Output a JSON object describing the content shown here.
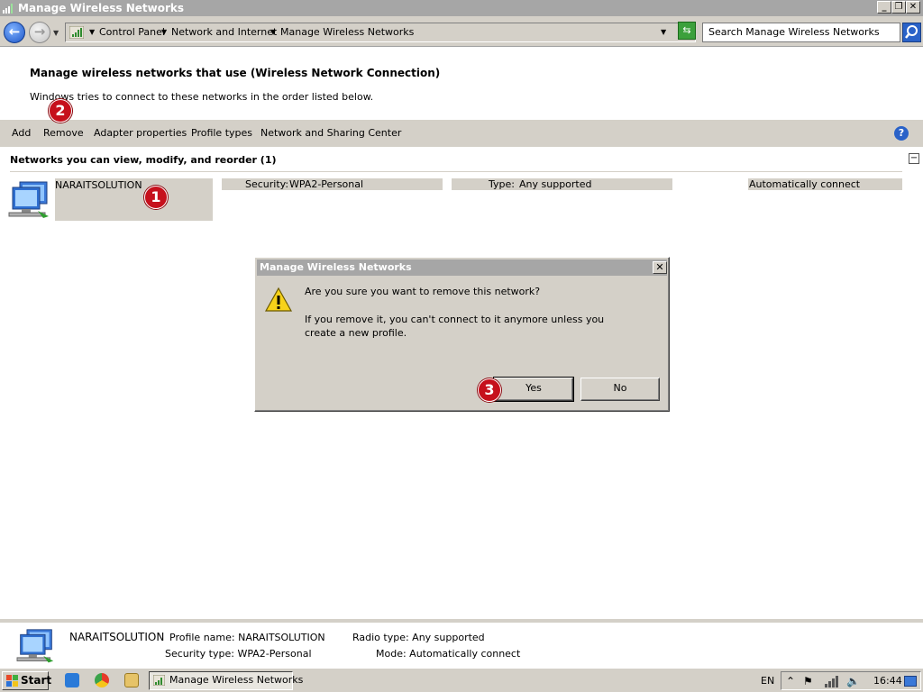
{
  "window": {
    "title": "Manage Wireless Networks",
    "minimize": "_",
    "maximize": "❐",
    "close": "✕"
  },
  "address_bar": {
    "back_arrow": "←",
    "forward_arrow": "→",
    "breadcrumbs": [
      "Control Panel",
      "Network and Internet",
      "Manage Wireless Networks"
    ],
    "search_placeholder": "Search Manage Wireless Networks"
  },
  "page": {
    "heading": "Manage wireless networks that use (Wireless Network Connection)",
    "subheading": "Windows tries to connect to these networks in the order listed below."
  },
  "toolbar": {
    "items": [
      "Add",
      "Remove",
      "Adapter properties",
      "Profile types",
      "Network and Sharing Center"
    ],
    "help_label": "?"
  },
  "group": {
    "header": "Networks you can view, modify, and reorder (1)",
    "collapse_label": "−"
  },
  "network": {
    "name": "NARAITSOLUTION",
    "security_label": "Security:",
    "security_value": "WPA2-Personal",
    "type_label": "Type:",
    "type_value": "Any supported",
    "connect_mode": "Automatically connect"
  },
  "badges": [
    "1",
    "2",
    "3"
  ],
  "dialog": {
    "title": "Manage Wireless Networks",
    "close": "✕",
    "question": "Are you sure you want to remove this network?",
    "message": "If you remove it, you can't connect to it anymore unless you create a new profile.",
    "yes_label": "Yes",
    "no_label": "No"
  },
  "details": {
    "name": "NARAITSOLUTION",
    "profile_name": "Profile name: NARAITSOLUTION",
    "security_type": "Security type: WPA2-Personal",
    "radio_type": "Radio type: Any supported",
    "mode": "Mode: Automatically connect"
  },
  "taskbar": {
    "start_label": "Start",
    "task_label": "Manage Wireless Networks",
    "language": "EN",
    "clock": "16:44"
  },
  "colors": {
    "chrome": "#d4d0c8",
    "titlebar": "#a6a6a6",
    "badge": "#c6101c",
    "accent_blue": "#2a62c8"
  }
}
